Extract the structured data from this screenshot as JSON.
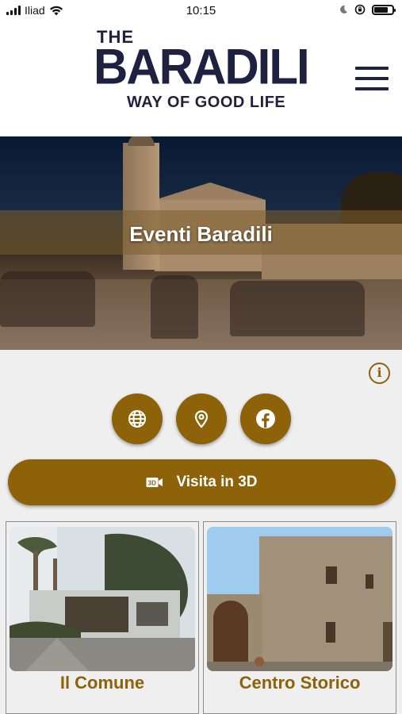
{
  "status_bar": {
    "carrier": "Iliad",
    "time": "10:15"
  },
  "header": {
    "logo": {
      "line1": "THE",
      "line2": "BARADILI",
      "line3": "WAY OF GOOD LIFE"
    },
    "menu_icon": "hamburger-menu-icon"
  },
  "hero": {
    "title": "Eventi Baradili"
  },
  "actions": {
    "info_icon": "info-icon",
    "circle_buttons": [
      {
        "icon": "globe-icon"
      },
      {
        "icon": "map-pin-icon"
      },
      {
        "icon": "facebook-icon"
      }
    ],
    "visit_3d_label": "Visita in 3D"
  },
  "cards": [
    {
      "label": "Il Comune"
    },
    {
      "label": "Centro Storico"
    }
  ],
  "colors": {
    "accent": "#8d6209",
    "logo": "#1f2140",
    "background": "#efefef"
  }
}
